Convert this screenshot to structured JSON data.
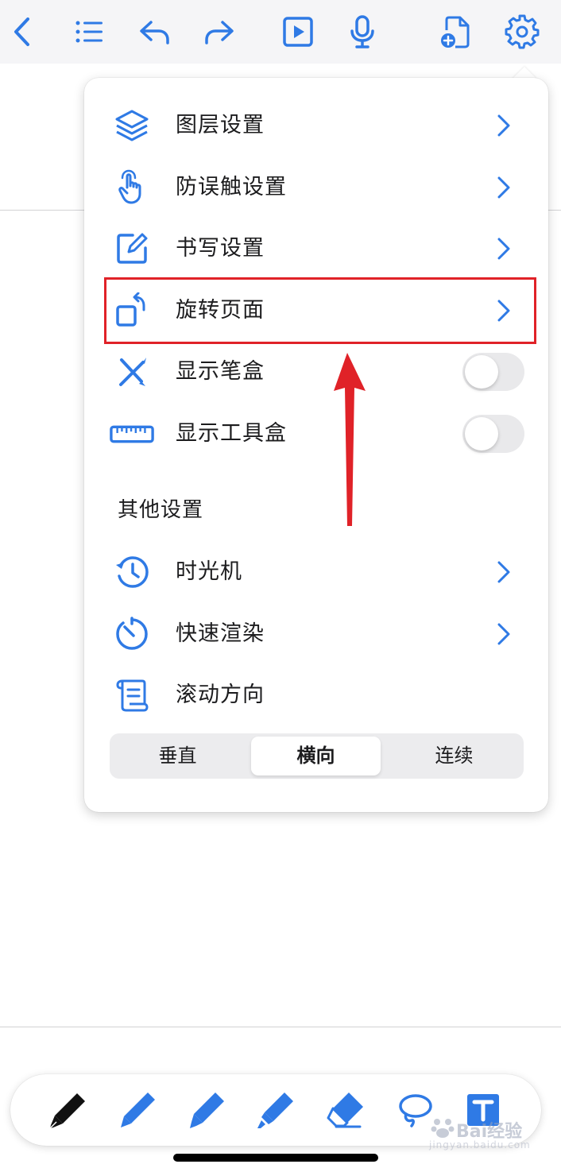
{
  "colors": {
    "accent": "#2f7ae5",
    "highlight": "#e02228",
    "toolbar_bg": "#f5f5f7"
  },
  "toolbar": {
    "icons": [
      "back-icon",
      "list-icon",
      "undo-icon",
      "redo-icon",
      "play-icon",
      "microphone-icon",
      "add-page-icon",
      "gear-icon"
    ]
  },
  "menu": {
    "items": [
      {
        "label": "图层设置",
        "icon": "layers-icon",
        "control": "chevron"
      },
      {
        "label": "防误触设置",
        "icon": "touch-hand-icon",
        "control": "chevron"
      },
      {
        "label": "书写设置",
        "icon": "edit-icon",
        "control": "chevron"
      },
      {
        "label": "旋转页面",
        "icon": "rotate-page-icon",
        "control": "chevron"
      },
      {
        "label": "显示笔盒",
        "icon": "pens-crossed-icon",
        "control": "toggle",
        "on": false
      },
      {
        "label": "显示工具盒",
        "icon": "ruler-icon",
        "control": "toggle",
        "on": false
      }
    ],
    "other_title": "其他设置",
    "other_items": [
      {
        "label": "时光机",
        "icon": "history-icon",
        "control": "chevron"
      },
      {
        "label": "快速渲染",
        "icon": "timer-icon",
        "control": "chevron"
      },
      {
        "label": "滚动方向",
        "icon": "scroll-icon",
        "control": "none"
      }
    ],
    "scroll_direction": {
      "options": [
        "垂直",
        "横向",
        "连续"
      ],
      "selected": "横向"
    }
  },
  "bottom_tools": [
    "fountain-pen-icon",
    "ballpoint-pen-icon",
    "brush-pen-icon",
    "highlighter-icon",
    "eraser-icon",
    "lasso-icon",
    "text-box-icon"
  ],
  "watermark": {
    "brand": "Bai经验",
    "sub": "jingyan.baidu.com"
  }
}
